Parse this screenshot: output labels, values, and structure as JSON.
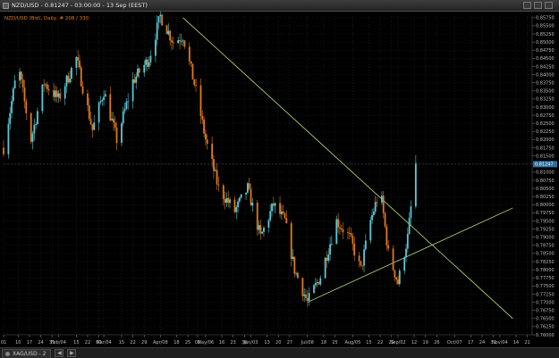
{
  "window": {
    "title": "NZD/USD - 0.81247 - 03:00:00 - 13 Sep (EEST)",
    "minimize_icon": "minimize-icon",
    "maximize_icon": "maximize-icon",
    "close_icon": "close-icon"
  },
  "legend": {
    "text": "NZD/USD (Bid), Daily, # 208 / 330",
    "color": "#e07a1a"
  },
  "statusbar": {
    "tab_label": "XAG/USD - 2",
    "nav_left": "◀",
    "nav_right": "▶"
  },
  "colors": {
    "background": "#000000",
    "grid": "#2a2a2a",
    "bull": "#5bc8d6",
    "bear": "#e07a1a",
    "trendline": "#b8e07a",
    "axis_text": "#bdbdbd",
    "price_marker_bg": "#2c6f9e"
  },
  "chart_data": {
    "type": "candlestick",
    "title": "",
    "series": [
      {
        "name": "NZD/USD (Bid), Daily",
        "current_price": 0.81247,
        "anchors": [
          [
            "2010-01-01",
            0.8175
          ],
          [
            "2010-01-10",
            0.843
          ],
          [
            "2010-01-18",
            0.82
          ],
          [
            "2010-01-26",
            0.8375
          ],
          [
            "2010-02-04",
            0.8325
          ],
          [
            "2010-02-15",
            0.845
          ],
          [
            "2010-02-25",
            0.823
          ],
          [
            "2010-03-04",
            0.835
          ],
          [
            "2010-03-12",
            0.82
          ],
          [
            "2010-03-22",
            0.838
          ],
          [
            "2010-04-01",
            0.845
          ],
          [
            "2010-04-08",
            0.858
          ],
          [
            "2010-04-16",
            0.85
          ],
          [
            "2010-04-22",
            0.852
          ],
          [
            "2010-04-30",
            0.835
          ],
          [
            "2010-05-06",
            0.82
          ],
          [
            "2010-05-14",
            0.805
          ],
          [
            "2010-05-24",
            0.798
          ],
          [
            "2010-06-01",
            0.805
          ],
          [
            "2010-06-09",
            0.79
          ],
          [
            "2010-06-17",
            0.8
          ],
          [
            "2010-06-24",
            0.795
          ],
          [
            "2010-06-30",
            0.78
          ],
          [
            "2010-07-08",
            0.77
          ],
          [
            "2010-07-16",
            0.778
          ],
          [
            "2010-07-26",
            0.795
          ],
          [
            "2010-08-03",
            0.79
          ],
          [
            "2010-08-10",
            0.78
          ],
          [
            "2010-08-16",
            0.795
          ],
          [
            "2010-08-22",
            0.805
          ],
          [
            "2010-08-27",
            0.785
          ],
          [
            "2010-09-02",
            0.776
          ],
          [
            "2010-09-08",
            0.79
          ],
          [
            "2010-09-13",
            0.8125
          ]
        ]
      }
    ],
    "trendlines": [
      {
        "from": [
          "2010-04-22",
          0.8575
        ],
        "to": [
          "2010-11-12",
          0.765
        ]
      },
      {
        "from": [
          "2010-07-08",
          0.77
        ],
        "to": [
          "2010-11-12",
          0.799
        ]
      }
    ],
    "y_axis": {
      "min": 0.76,
      "max": 0.858,
      "step": 0.0025,
      "decimals": 5,
      "ticks": [
        "0.85750",
        "0.85500",
        "0.85250",
        "0.85000",
        "0.84750",
        "0.84500",
        "0.84250",
        "0.84000",
        "0.83750",
        "0.83500",
        "0.83250",
        "0.83000",
        "0.82750",
        "0.82500",
        "0.82250",
        "0.82000",
        "0.81750",
        "0.81500",
        "0.81250",
        "0.81000",
        "0.80750",
        "0.80500",
        "0.80250",
        "0.80000",
        "0.79750",
        "0.79500",
        "0.79250",
        "0.79000",
        "0.78750",
        "0.78500",
        "0.78250",
        "0.78000",
        "0.77750",
        "0.77500",
        "0.77250",
        "0.77000",
        "0.76750",
        "0.76500",
        "0.76250",
        "0.76000"
      ]
    },
    "x_axis": {
      "start": "2010-01-01",
      "end": "2010-11-24",
      "labels": [
        {
          "date": "2010-01-01",
          "text": "01"
        },
        {
          "date": "2010-01-10",
          "text": "10"
        },
        {
          "date": "2010-01-17",
          "text": "17"
        },
        {
          "date": "2010-01-24",
          "text": "24"
        },
        {
          "date": "2010-01-31",
          "text": "31"
        },
        {
          "date": "2010-02-04",
          "text": "Feb/04"
        },
        {
          "date": "2010-02-15",
          "text": "15"
        },
        {
          "date": "2010-02-22",
          "text": "22"
        },
        {
          "date": "2010-03-01",
          "text": "01"
        },
        {
          "date": "2010-03-04",
          "text": "Mar/04"
        },
        {
          "date": "2010-03-15",
          "text": "15"
        },
        {
          "date": "2010-03-22",
          "text": "22"
        },
        {
          "date": "2010-03-29",
          "text": "29"
        },
        {
          "date": "2010-04-08",
          "text": "Apr/08"
        },
        {
          "date": "2010-04-18",
          "text": "18"
        },
        {
          "date": "2010-04-25",
          "text": "25"
        },
        {
          "date": "2010-05-01",
          "text": "01"
        },
        {
          "date": "2010-05-06",
          "text": "May/06"
        },
        {
          "date": "2010-05-16",
          "text": "16"
        },
        {
          "date": "2010-05-23",
          "text": "23"
        },
        {
          "date": "2010-05-30",
          "text": "30"
        },
        {
          "date": "2010-06-03",
          "text": "Jun/03"
        },
        {
          "date": "2010-06-13",
          "text": "13"
        },
        {
          "date": "2010-06-20",
          "text": "20"
        },
        {
          "date": "2010-06-27",
          "text": "27"
        },
        {
          "date": "2010-07-08",
          "text": "Jul/08"
        },
        {
          "date": "2010-07-18",
          "text": "18"
        },
        {
          "date": "2010-07-25",
          "text": "25"
        },
        {
          "date": "2010-08-05",
          "text": "Aug/05"
        },
        {
          "date": "2010-08-15",
          "text": "15"
        },
        {
          "date": "2010-08-22",
          "text": "22"
        },
        {
          "date": "2010-08-29",
          "text": "29"
        },
        {
          "date": "2010-09-02",
          "text": "Sep/02"
        },
        {
          "date": "2010-09-12",
          "text": "12"
        },
        {
          "date": "2010-09-19",
          "text": "19"
        },
        {
          "date": "2010-09-26",
          "text": "26"
        },
        {
          "date": "2010-10-07",
          "text": "Oct/07"
        },
        {
          "date": "2010-10-17",
          "text": "17"
        },
        {
          "date": "2010-10-24",
          "text": "24"
        },
        {
          "date": "2010-10-31",
          "text": "31"
        },
        {
          "date": "2010-11-04",
          "text": "Nov/04"
        },
        {
          "date": "2010-11-14",
          "text": "14"
        },
        {
          "date": "2010-11-21",
          "text": "21"
        }
      ]
    },
    "grid": true,
    "legend_position": "top-left"
  }
}
